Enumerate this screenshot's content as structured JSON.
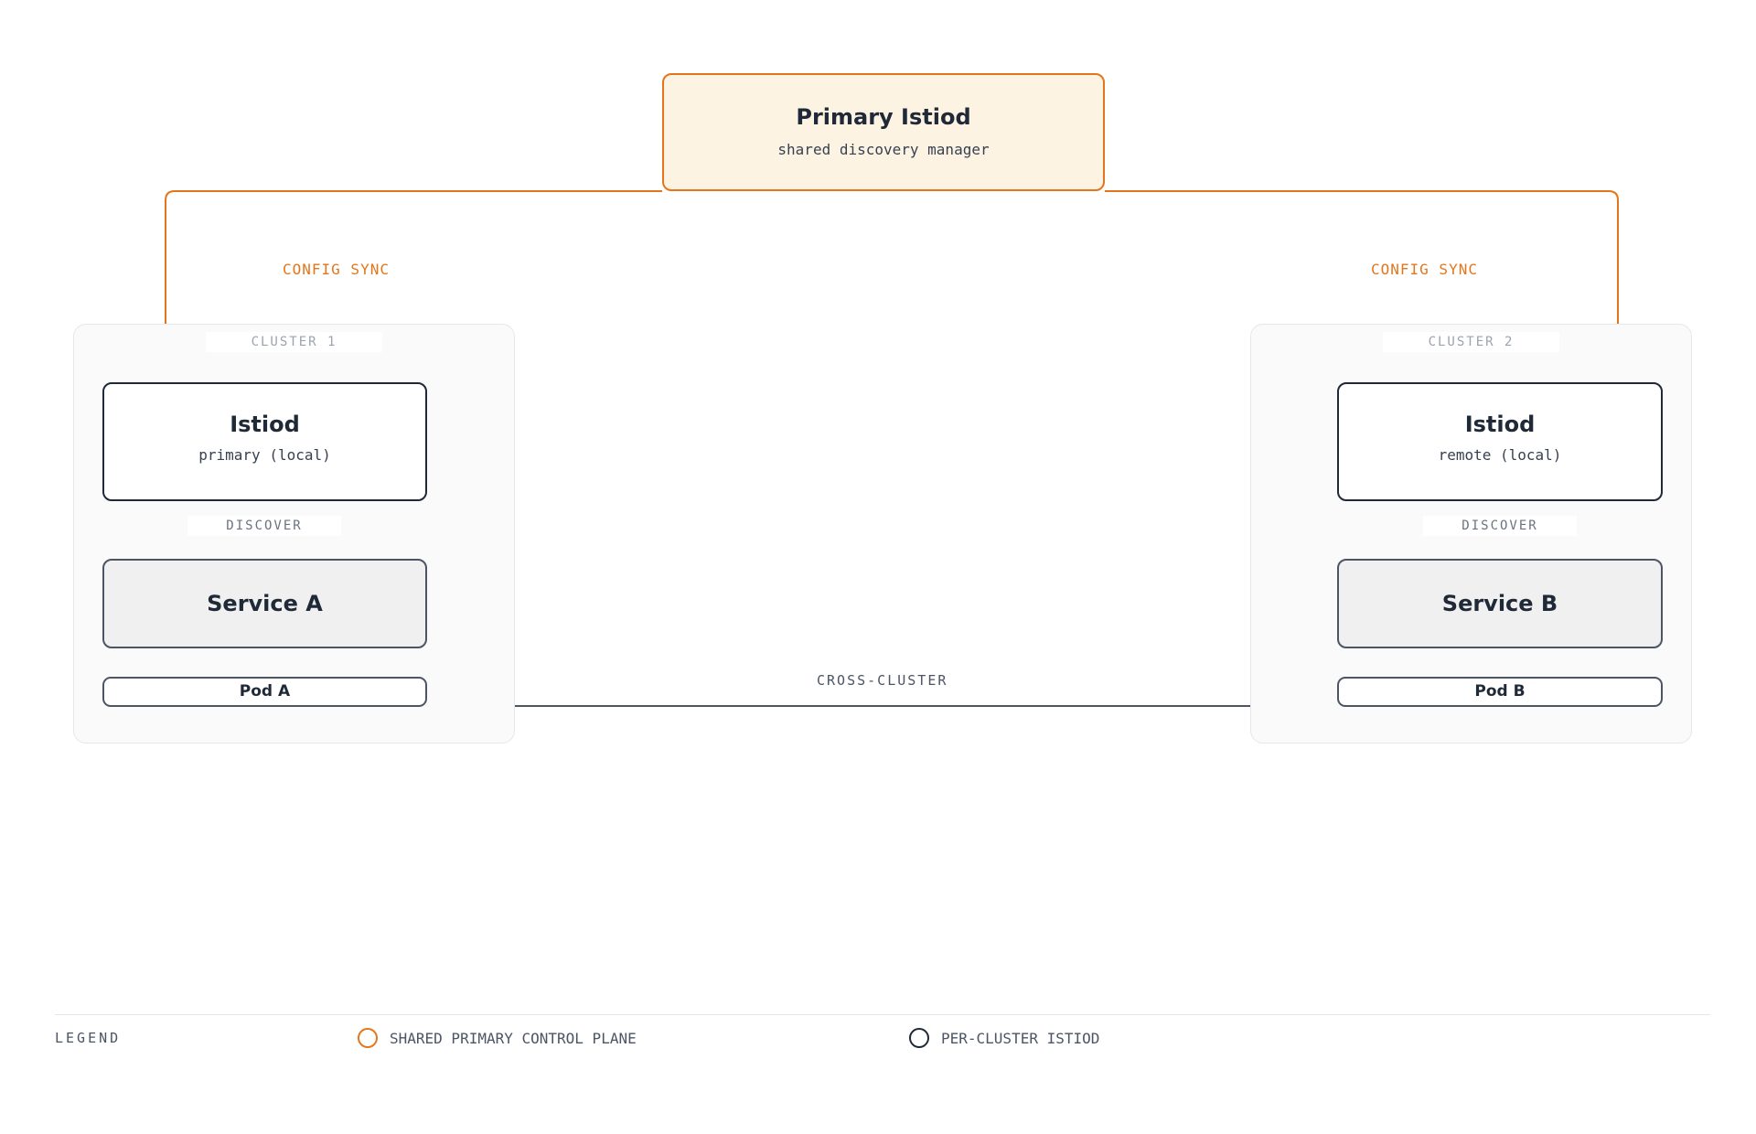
{
  "primary": {
    "title": "Primary Istiod",
    "subtitle": "shared discovery manager"
  },
  "config_sync": {
    "left_label": "CONFIG SYNC",
    "right_label": "CONFIG SYNC"
  },
  "clusters": [
    {
      "tag": "CLUSTER 1",
      "istiod": {
        "title": "Istiod",
        "subtitle": "primary (local)"
      },
      "discover_label": "DISCOVER",
      "service": "Service A",
      "pod": "Pod A"
    },
    {
      "tag": "CLUSTER 2",
      "istiod": {
        "title": "Istiod",
        "subtitle": "remote (local)"
      },
      "discover_label": "DISCOVER",
      "service": "Service B",
      "pod": "Pod B"
    }
  ],
  "cross_cluster_label": "CROSS-CLUSTER",
  "legend": {
    "title": "LEGEND",
    "items": [
      {
        "label": "SHARED PRIMARY CONTROL PLANE",
        "color": "#e3761c"
      },
      {
        "label": "PER-CLUSTER ISTIOD",
        "color": "#1f2937"
      }
    ]
  },
  "colors": {
    "accent": "#e3761c",
    "dark": "#1f2937",
    "arrow": "#4b5563"
  }
}
